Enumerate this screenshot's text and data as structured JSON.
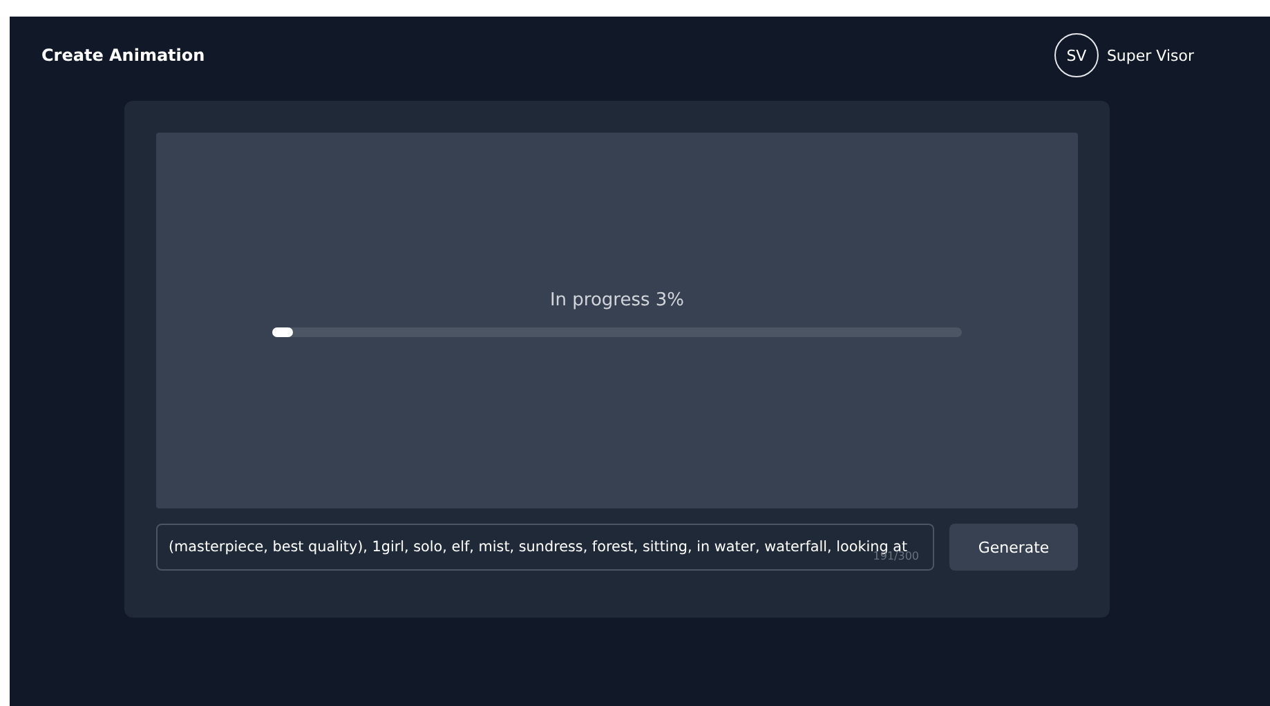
{
  "header": {
    "title": "Create Animation",
    "user": {
      "initials": "SV",
      "name": "Super Visor"
    }
  },
  "preview": {
    "status": "In progress 3%",
    "level": 0.03
  },
  "prompt": {
    "value": "(masterpiece, best quality), 1girl, solo, elf, mist, sundress, forest, sitting, in water, waterfall, looking at",
    "counter": "191/300"
  },
  "button": "Generate"
}
